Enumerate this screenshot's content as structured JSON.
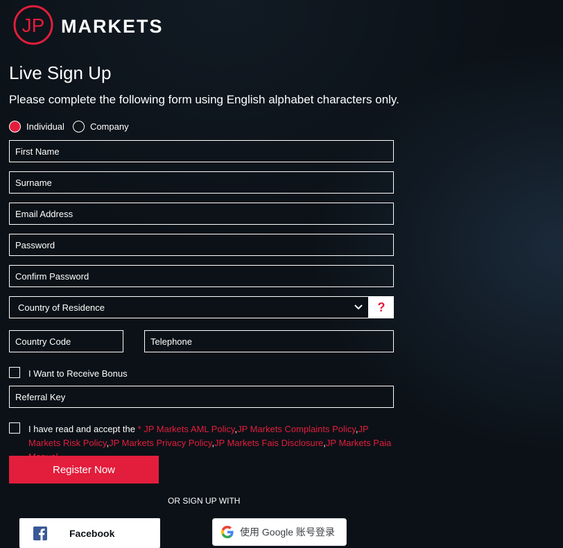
{
  "brand": {
    "logo_letters": "JP",
    "name": "MARKETS"
  },
  "form": {
    "title": "Live Sign Up",
    "subtitle": "Please complete the following form using English alphabet characters only.",
    "account_type": {
      "options": [
        "Individual",
        "Company"
      ],
      "selected": "Individual"
    },
    "fields": {
      "first_name": "First Name",
      "surname": "Surname",
      "email": "Email Address",
      "password": "Password",
      "confirm_password": "Confirm Password",
      "country": "Country of Residence",
      "country_help": "?",
      "country_code": "Country Code",
      "telephone": "Telephone",
      "referral": "Referral Key"
    },
    "bonus_label": "I Want to Receive Bonus",
    "terms": {
      "prefix": "I have read and accept the ",
      "asterisk": "* ",
      "links": [
        "JP Markets AML Policy",
        "JP Markets Complaints Policy",
        "JP Markets Risk Policy",
        "JP Markets Privacy Policy",
        "JP Markets Fais Disclosure",
        "JP Markets Paia Manual"
      ],
      "separator": ","
    },
    "register_label": "Register Now",
    "or_text": "OR SIGN UP WITH",
    "facebook_label": "Facebook",
    "google_label": "使用 Google 账号登录"
  },
  "colors": {
    "accent": "#e31d3c",
    "background": "#0b1117"
  }
}
